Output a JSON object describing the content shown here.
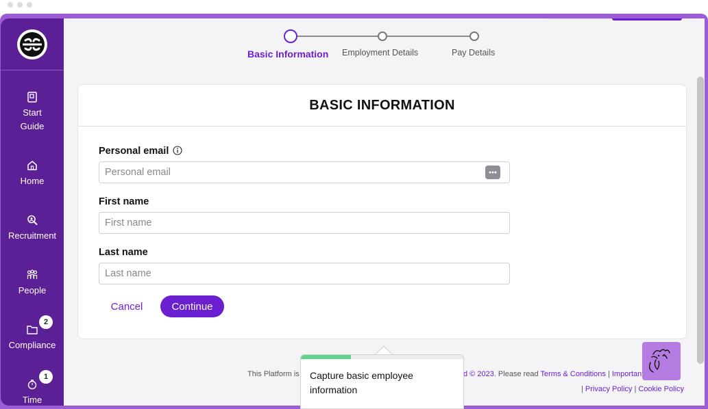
{
  "stepper": {
    "steps": [
      {
        "label": "Basic Information",
        "active": true
      },
      {
        "label": "Employment Details",
        "active": false
      },
      {
        "label": "Pay Details",
        "active": false
      }
    ]
  },
  "sidebar": {
    "items": [
      {
        "label": "Start\nGuide",
        "icon": "book-icon"
      },
      {
        "label": "Home",
        "icon": "home-icon"
      },
      {
        "label": "Recruitment",
        "icon": "search-person-icon"
      },
      {
        "label": "People",
        "icon": "people-icon"
      },
      {
        "label": "Compliance",
        "icon": "folder-icon",
        "badge": "2"
      },
      {
        "label": "Time",
        "icon": "stopwatch-icon",
        "badge": "1"
      }
    ]
  },
  "form": {
    "title": "BASIC INFORMATION",
    "email_label": "Personal email",
    "email_placeholder": "Personal email",
    "first_label": "First name",
    "first_placeholder": "First name",
    "last_label": "Last name",
    "last_placeholder": "Last name",
    "cancel": "Cancel",
    "continue": "Continue"
  },
  "footer": {
    "prefix": "This Platform is",
    "mid": "d © 2023. Please read",
    "terms": "Terms & Conditions",
    "sep": "|",
    "important": "Important",
    "important_tail": "n",
    "privacy": "Privacy Policy",
    "cookie": "Cookie Policy"
  },
  "tooltip": {
    "text": "Capture basic employee information",
    "progress": 0.31
  },
  "colors": {
    "brand": "#6a1fd0",
    "sidebar": "#5b1f96",
    "frame": "#9c5cd6",
    "progress": "#5fd48a"
  }
}
